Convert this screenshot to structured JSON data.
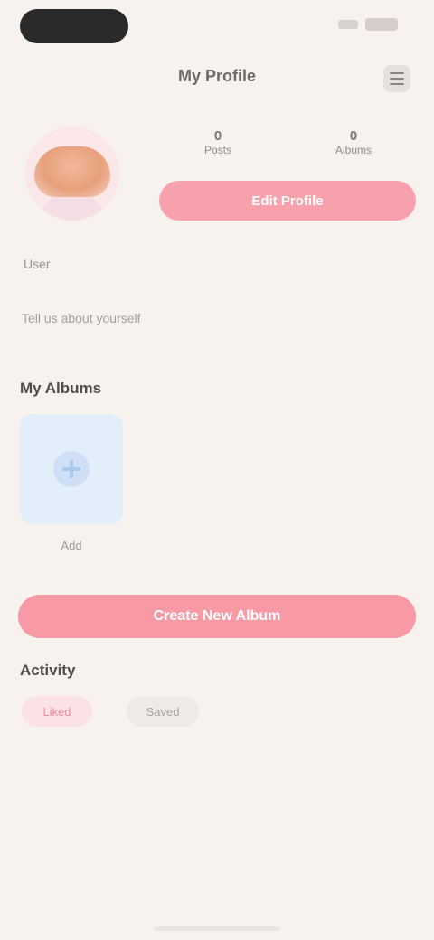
{
  "header": {
    "title": "My Profile"
  },
  "profile": {
    "stats": [
      {
        "value": "0",
        "label": "Posts"
      },
      {
        "value": "0",
        "label": "Albums"
      }
    ],
    "edit_label": "Edit Profile",
    "username": "User",
    "bio": "Tell us about yourself"
  },
  "albums": {
    "title": "My Albums",
    "new_album_label": "Add"
  },
  "create_label": "Create New Album",
  "activity": {
    "title": "Activity",
    "tabs": [
      {
        "label": "Liked",
        "active": true
      },
      {
        "label": "Saved",
        "active": false
      }
    ]
  },
  "colors": {
    "accent": "#f89aa6",
    "background": "#f7f2ee",
    "album_card": "#e3eefb"
  }
}
